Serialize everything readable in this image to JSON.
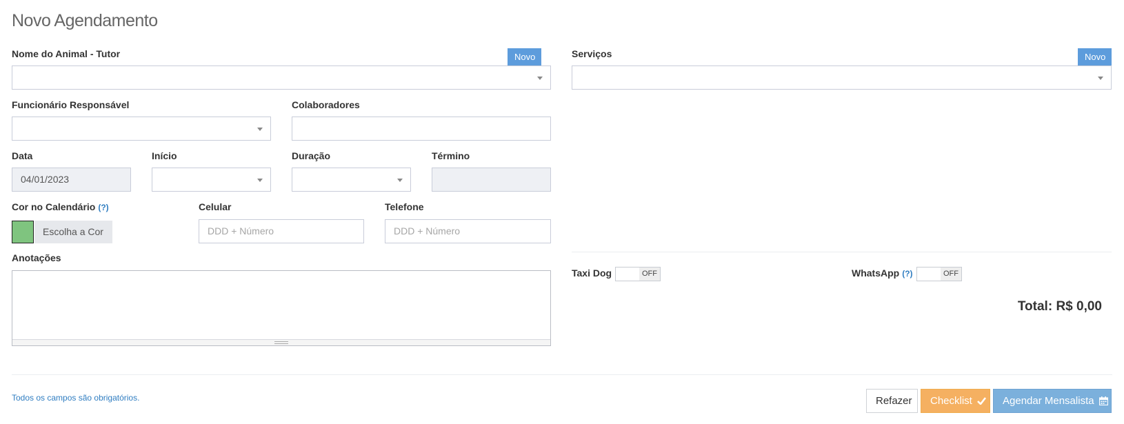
{
  "page_title": "Novo Agendamento",
  "animal": {
    "label": "Nome do Animal - Tutor",
    "new_button": "Novo",
    "value": ""
  },
  "servicos": {
    "label": "Serviços",
    "new_button": "Novo",
    "value": ""
  },
  "funcionario": {
    "label": "Funcionário Responsável",
    "value": ""
  },
  "colaboradores": {
    "label": "Colaboradores",
    "value": ""
  },
  "data": {
    "label": "Data",
    "value": "04/01/2023"
  },
  "inicio": {
    "label": "Início",
    "value": ""
  },
  "duracao": {
    "label": "Duração",
    "value": ""
  },
  "termino": {
    "label": "Término",
    "value": ""
  },
  "cor": {
    "label": "Cor no Calendário",
    "help": "(?)",
    "button": "Escolha a Cor",
    "color": "#7fc47f"
  },
  "celular": {
    "label": "Celular",
    "placeholder": "DDD + Número"
  },
  "telefone": {
    "label": "Telefone",
    "placeholder": "DDD + Número"
  },
  "anotacoes": {
    "label": "Anotações",
    "value": ""
  },
  "taxi_dog": {
    "label": "Taxi Dog",
    "state": "OFF"
  },
  "whatsapp": {
    "label": "WhatsApp",
    "help": "(?)",
    "state": "OFF"
  },
  "total": "Total: R$ 0,00",
  "footer": {
    "note": "Todos os campos são obrigatórios.",
    "refazer": "Refazer",
    "checklist": "Checklist",
    "checklist_icon": "check-icon",
    "mensalista": "Agendar Mensalista",
    "mensalista_icon": "calendar-icon"
  },
  "colors": {
    "primary": "#5d9cdc",
    "warning": "#f5b061",
    "info": "#7bb0dc",
    "link": "#2f7dc1"
  }
}
